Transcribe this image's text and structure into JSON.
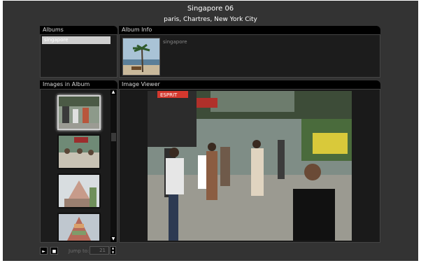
{
  "header": {
    "title": "Singapore 06",
    "subtitle": "paris, Chartres, New York City"
  },
  "albums": {
    "label": "Albums",
    "items": [
      "singapore"
    ]
  },
  "album_info": {
    "label": "Album Info",
    "name": "singapore"
  },
  "images_in_album": {
    "label": "Images in Album"
  },
  "image_viewer": {
    "label": "Image Viewer",
    "sign_text": "ESPRIT"
  },
  "controls": {
    "jump_label": "Jump to:",
    "jump_value": "21",
    "play_symbol": "►",
    "stop_symbol": "■",
    "up_arrow": "▲",
    "down_arrow": "▼"
  }
}
